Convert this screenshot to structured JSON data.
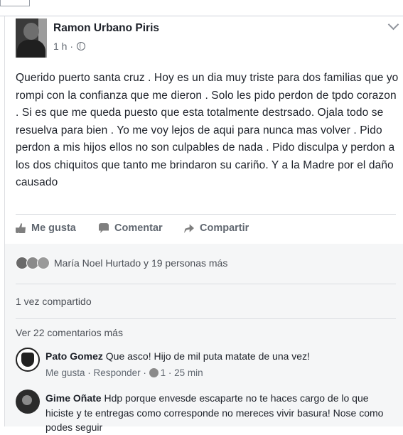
{
  "post": {
    "author": "Ramon Urbano Piris",
    "time": "1 h ·",
    "text": "Querido puerto santa cruz . Hoy es un dia muy triste para dos familias que yo rompi con la confianza que me dieron . Solo les pido perdon de tpdo corazon . Si es que me queda puesto que esta totalmente destrsado. Ojala todo se resuelva para bien . Yo me voy lejos de aqui para nunca mas volver . Pido perdon a mis hijos ellos no son culpables de nada . Pido disculpa y perdon a los dos chiquitos que tanto me brindaron su cariño. Y a la Madre por el daño causado"
  },
  "actions": {
    "like": "Me gusta",
    "comment": "Comentar",
    "share": "Compartir"
  },
  "reactions": {
    "summary": "María Noel Hurtado y 19 personas más",
    "icons": [
      "angry-react-icon",
      "like-react-icon",
      "wow-react-icon"
    ]
  },
  "shares": "1 vez compartido",
  "view_more_comments": "Ver 22 comentarios más",
  "comments": [
    {
      "name": "Pato Gomez",
      "text": "Que asco! Hijo de mil puta matate de una vez!",
      "like_label": "Me gusta",
      "reply_label": "Responder",
      "like_count": "1",
      "time": "25 min"
    },
    {
      "name": "Gime Oñate",
      "text": "Hdp porque envesde escaparte no te haces cargo de lo que hiciste y te entregas como corresponde no mereces vivir basura! Nose como podes seguir"
    }
  ],
  "colors": {
    "text": "#1d2129",
    "secondary": "#606770",
    "panel": "#f5f6f7"
  }
}
